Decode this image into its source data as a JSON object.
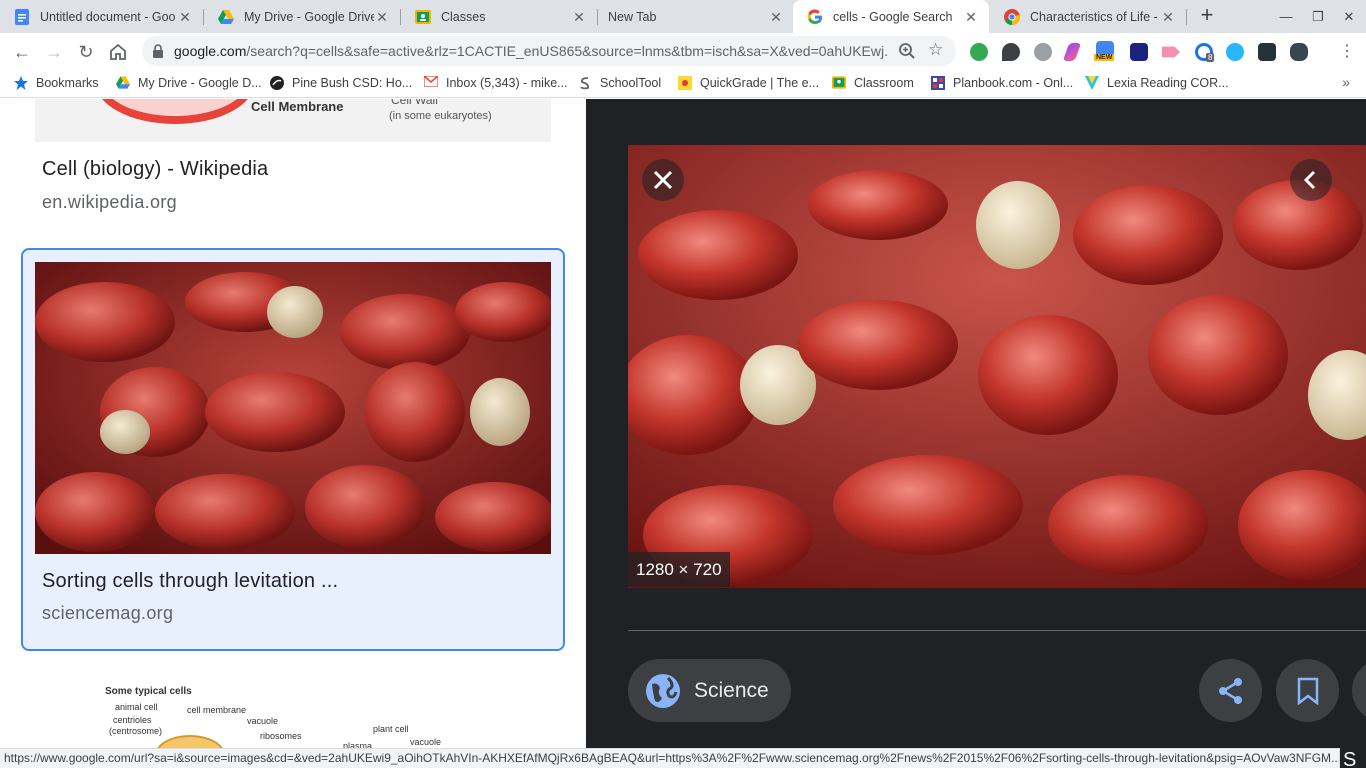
{
  "tabs": [
    {
      "title": "Untitled document - Goo",
      "icon": "docs-icon",
      "active": false
    },
    {
      "title": "My Drive - Google Drive",
      "icon": "drive-icon",
      "active": false
    },
    {
      "title": "Classes",
      "icon": "classroom-icon",
      "active": false
    },
    {
      "title": "New Tab",
      "icon": "",
      "active": false
    },
    {
      "title": "cells - Google Search",
      "icon": "google-icon",
      "active": true
    },
    {
      "title": "Characteristics of Life - F",
      "icon": "chrome-icon",
      "active": false
    }
  ],
  "toolbar": {
    "url_host": "google.com",
    "url_path": "/search?q=cells&safe=active&rlz=1CACTIE_enUS865&source=lnms&tbm=isch&sa=X&ved=0ahUKEwj..."
  },
  "extensions": {
    "badge_new": "NEW",
    "badge_count": "8"
  },
  "bookmarks": [
    {
      "label": "Bookmarks"
    },
    {
      "label": "My Drive - Google D..."
    },
    {
      "label": "Pine Bush CSD: Ho..."
    },
    {
      "label": "Inbox (5,343) - mike..."
    },
    {
      "label": "SchoolTool"
    },
    {
      "label": "QuickGrade | The e..."
    },
    {
      "label": "Classroom"
    },
    {
      "label": "Planbook.com - Onl..."
    },
    {
      "label": "Lexia Reading COR..."
    }
  ],
  "results": {
    "top_thumb": {
      "label_membrane": "Cell Membrane",
      "label_wall": "Cell Wall",
      "label_wall_note": "(in some eukaryotes)"
    },
    "first": {
      "title": "Cell (biology) - Wikipedia",
      "site": "en.wikipedia.org"
    },
    "selected": {
      "title": "Sorting cells through levitation ...",
      "site": "sciencemag.org"
    },
    "bottom_thumb": {
      "heading": "Some typical cells",
      "labels": [
        "animal cell",
        "cell membrane",
        "centrioles",
        "(centrosome)",
        "vacuole",
        "ribosomes",
        "plant cell",
        "vacuole",
        "plasma"
      ]
    }
  },
  "preview": {
    "dimensions": "1280 × 720",
    "category_chip": "Science"
  },
  "status": {
    "url": "https://www.google.com/url?sa=i&source=images&cd=&ved=2ahUKEwi9_aOihOTkAhVIn-AKHXEfAfMQjRx6BAgBEAQ&url=https%3A%2F%2Fwww.sciencemag.org%2Fnews%2F2015%2F06%2Fsorting-cells-through-levitation&psig=AOvVaw3NFGM...",
    "tail": "S"
  }
}
